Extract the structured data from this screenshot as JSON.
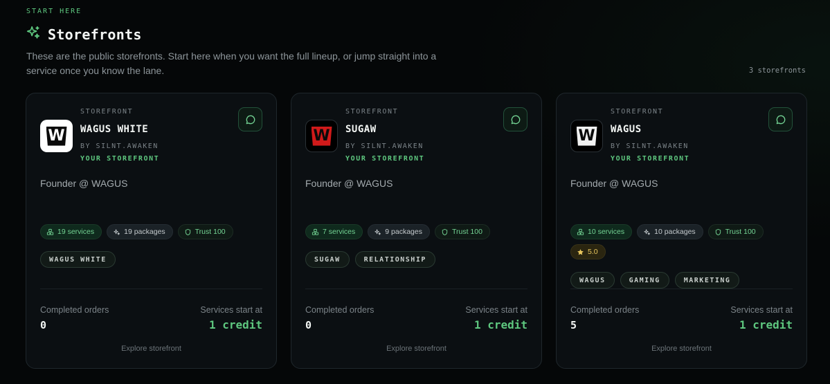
{
  "header": {
    "eyebrow": "START HERE",
    "title": "Storefronts",
    "title_icon": "sparkle-icon",
    "intro": "These are the public storefronts. Start here when you want the full lineup, or jump straight into a service once you know the lane.",
    "count": "3 storefronts"
  },
  "colors": {
    "accent": "#5ec77f",
    "background": "#050708",
    "card": "#0b0f12",
    "gold": "#e9c75e"
  },
  "cards": [
    {
      "eyebrow": "STOREFRONT",
      "logo_letter": "W",
      "name": "WAGUS WHITE",
      "byline": "BY SILNT.AWAKEN",
      "ownership": "YOUR STOREFRONT",
      "bio": "Founder @ WAGUS",
      "services": "19 services",
      "packages": "19 packages",
      "trust": "Trust 100",
      "tags": [
        "WAGUS WHITE"
      ],
      "completed_label": "Completed orders",
      "completed": "0",
      "start_label": "Services start at",
      "start": "1 credit",
      "explore": "Explore storefront"
    },
    {
      "eyebrow": "STOREFRONT",
      "logo_letter": "W",
      "name": "SUGAW",
      "byline": "BY SILNT.AWAKEN",
      "ownership": "YOUR STOREFRONT",
      "bio": "Founder @ WAGUS",
      "services": "7 services",
      "packages": "9 packages",
      "trust": "Trust 100",
      "tags": [
        "SUGAW",
        "RELATIONSHIP"
      ],
      "completed_label": "Completed orders",
      "completed": "0",
      "start_label": "Services start at",
      "start": "1 credit",
      "explore": "Explore storefront"
    },
    {
      "eyebrow": "STOREFRONT",
      "logo_letter": "W",
      "name": "WAGUS",
      "byline": "BY SILNT.AWAKEN",
      "ownership": "YOUR STOREFRONT",
      "bio": "Founder @ WAGUS",
      "services": "10 services",
      "packages": "10 packages",
      "trust": "Trust 100",
      "rating": "5.0",
      "tags": [
        "WAGUS",
        "GAMING",
        "MARKETING"
      ],
      "completed_label": "Completed orders",
      "completed": "5",
      "start_label": "Services start at",
      "start": "1 credit",
      "explore": "Explore storefront"
    }
  ]
}
